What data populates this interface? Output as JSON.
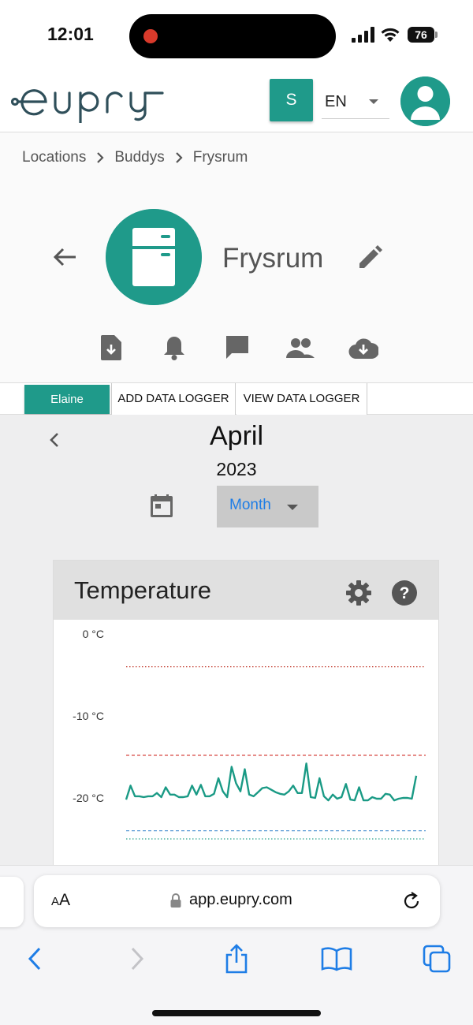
{
  "status_bar": {
    "time": "12:01",
    "battery": "76"
  },
  "header": {
    "logo_text": "eupry",
    "user_button": "S",
    "language": "EN"
  },
  "breadcrumb": [
    "Locations",
    "Buddys",
    "Frysrum"
  ],
  "location": {
    "title": "Frysrum",
    "icon": "fridge-icon"
  },
  "actions": [
    "document-download-icon",
    "bell-icon",
    "comment-icon",
    "people-icon",
    "cloud-download-icon"
  ],
  "tabs": {
    "elaine": "Elaine",
    "add_logger": "ADD DATA LOGGER",
    "view_logger": "VIEW DATA LOGGER"
  },
  "period": {
    "month": "April",
    "year": "2023",
    "view": "Month"
  },
  "temperature_card": {
    "title": "Temperature"
  },
  "chart_data": {
    "type": "line",
    "yticks": [
      "0 °C",
      "-10 °C",
      "-20 °C"
    ],
    "thresholds": [
      {
        "value": -4,
        "style": "dotted",
        "color": "#c0392b"
      },
      {
        "value": -14.8,
        "style": "dashed",
        "color": "#d9534f"
      },
      {
        "value": -24,
        "style": "dashed",
        "color": "#5b9bd5"
      },
      {
        "value": -25,
        "style": "dotted",
        "color": "#2ca58d"
      }
    ],
    "series": [
      {
        "color": "#1a9a85",
        "values": [
          -20.2,
          -18.5,
          -19.8,
          -19.8,
          -19.9,
          -19.8,
          -19.8,
          -19.4,
          -19.9,
          -18.7,
          -19.6,
          -19.6,
          -19.9,
          -19.9,
          -19.8,
          -18.5,
          -19.6,
          -18.4,
          -19.8,
          -19.8,
          -19.5,
          -17.6,
          -19.2,
          -19.9,
          -16.2,
          -18.2,
          -19.2,
          -16.5,
          -19.6,
          -19.8,
          -19.3,
          -18.8,
          -18.7,
          -19.0,
          -19.3,
          -19.5,
          -19.6,
          -19.2,
          -18.5,
          -19.4,
          -19.4,
          -15.8,
          -19.9,
          -20.0,
          -17.6,
          -19.8,
          -20.3,
          -19.6,
          -20.1,
          -19.9,
          -18.3,
          -20.2,
          -20.3,
          -18.7,
          -20.3,
          -20.3,
          -19.9,
          -20.1,
          -20.1,
          -19.5,
          -19.6,
          -20.3,
          -20.1,
          -20.0,
          -20.0,
          -20.1,
          -17.3
        ]
      }
    ],
    "ylim": [
      -28,
      1
    ]
  },
  "browser": {
    "aa_label_small": "A",
    "aa_label_big": "A",
    "url": "app.eupry.com"
  }
}
